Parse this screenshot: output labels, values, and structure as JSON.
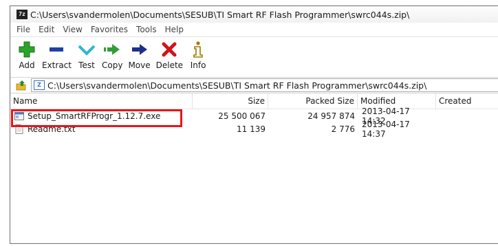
{
  "window": {
    "title": "C:\\Users\\svandermolen\\Documents\\SESUB\\TI Smart RF Flash Programmer\\swrc044s.zip\\",
    "app_icon_text": "7z"
  },
  "menu": [
    "File",
    "Edit",
    "View",
    "Favorites",
    "Tools",
    "Help"
  ],
  "toolbar": {
    "add": "Add",
    "extract": "Extract",
    "test": "Test",
    "copy": "Copy",
    "move": "Move",
    "delete": "Delete",
    "info": "Info"
  },
  "address": {
    "path": "C:\\Users\\svandermolen\\Documents\\SESUB\\TI Smart RF Flash Programmer\\swrc044s.zip\\"
  },
  "columns": {
    "name": "Name",
    "size": "Size",
    "packed": "Packed Size",
    "modified": "Modified",
    "created": "Created"
  },
  "files": [
    {
      "name": "Setup_SmartRFProgr_1.12.7.exe",
      "size": "25 500 067",
      "packed": "24 957 874",
      "modified": "2013-04-17 14:32",
      "icon": "exe-file-icon"
    },
    {
      "name": "Readme.txt",
      "size": "11 139",
      "packed": "2 776",
      "modified": "2013-04-17 14:37",
      "icon": "text-file-icon"
    }
  ],
  "colors": {
    "highlight": "#e8141b",
    "add_icon": "#2aa52a",
    "extract_icon": "#1f3fa8",
    "test_icon": "#2cb6d6",
    "copy_icon": "#2f9d3a",
    "move_icon": "#1d2f8c",
    "delete_icon": "#d0141b",
    "info_icon": "#a07a00"
  }
}
